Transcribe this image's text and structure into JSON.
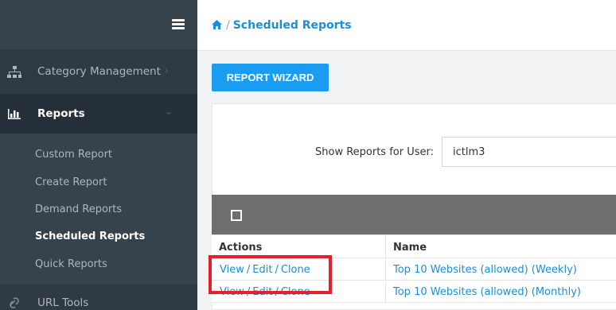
{
  "sidebar": {
    "items": {
      "category": {
        "label": "Category Management",
        "icon": "sitemap-icon"
      },
      "reports": {
        "label": "Reports",
        "icon": "bar-chart-icon"
      },
      "url_tools": {
        "label": "URL Tools",
        "icon": "url-tools-icon"
      }
    },
    "submenu": [
      {
        "label": "Custom Report"
      },
      {
        "label": "Create Report"
      },
      {
        "label": "Demand Reports"
      },
      {
        "label": "Scheduled Reports",
        "active": true
      },
      {
        "label": "Quick Reports"
      }
    ]
  },
  "header": {
    "breadcrumb_sep": "/",
    "breadcrumb_current": "Scheduled Reports"
  },
  "main": {
    "wizard_label": "REPORT WIZARD",
    "user_label": "Show Reports for User:",
    "user_value": "ictlm3",
    "table": {
      "headers": {
        "actions": "Actions",
        "name": "Name"
      },
      "actions": {
        "view": "View",
        "edit": "Edit",
        "clone": "Clone",
        "sep": "/"
      },
      "rows": [
        {
          "name": "Top 10 Websites (allowed) (Weekly)"
        },
        {
          "name": "Top 10 Websites (allowed) (Monthly)"
        }
      ]
    }
  },
  "colors": {
    "accent": "#1a9cf0",
    "link": "#1a8fd8",
    "sidebar": "#2f3a44",
    "highlight": "#e6202a"
  }
}
